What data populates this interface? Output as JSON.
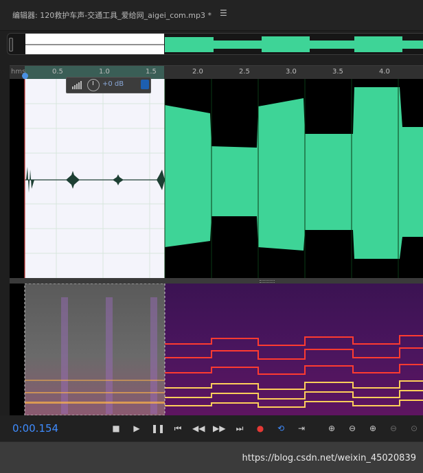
{
  "window": {
    "title": "编辑器: 120救护车声-交通工具_爱给网_aigei_com.mp3 *",
    "menu_icon": "hamburger-menu-icon"
  },
  "ruler": {
    "unit": "hms",
    "ticks": [
      "0.5",
      "1.0",
      "1.5",
      "2.0",
      "2.5",
      "3.0",
      "3.5",
      "4.0"
    ]
  },
  "hud": {
    "volume_value": "+0 dB",
    "icons": [
      "level-bars-icon",
      "volume-knob-icon",
      "pin-icon"
    ]
  },
  "transport": {
    "timecode": "0:00.154",
    "buttons": [
      {
        "name": "stop-button",
        "icon": "stop-icon"
      },
      {
        "name": "play-button",
        "icon": "play-icon"
      },
      {
        "name": "pause-button",
        "icon": "pause-icon"
      },
      {
        "name": "go-to-start-button",
        "icon": "skip-back-icon"
      },
      {
        "name": "rewind-button",
        "icon": "rewind-icon"
      },
      {
        "name": "fast-forward-button",
        "icon": "fast-forward-icon"
      },
      {
        "name": "go-to-end-button",
        "icon": "skip-forward-icon"
      },
      {
        "name": "record-button",
        "icon": "record-icon"
      },
      {
        "name": "loop-playback-button",
        "icon": "loop-icon"
      },
      {
        "name": "skip-selection-button",
        "icon": "skip-selection-icon"
      },
      {
        "name": "zoom-in-amplitude-button",
        "icon": "zoom-in-amplitude-icon"
      },
      {
        "name": "zoom-out-amplitude-button",
        "icon": "zoom-out-amplitude-icon"
      },
      {
        "name": "zoom-in-time-button",
        "icon": "zoom-in-time-icon"
      },
      {
        "name": "zoom-out-full-button",
        "icon": "zoom-out-full-icon"
      },
      {
        "name": "zoom-selection-button",
        "icon": "zoom-selection-icon"
      }
    ]
  },
  "colors": {
    "accent": "#3f8cff",
    "waveform": "#3ed497",
    "selection_bg": "#f4f4fb",
    "record": "#e53935"
  },
  "watermark": "https://blog.csdn.net/weixin_45020839"
}
